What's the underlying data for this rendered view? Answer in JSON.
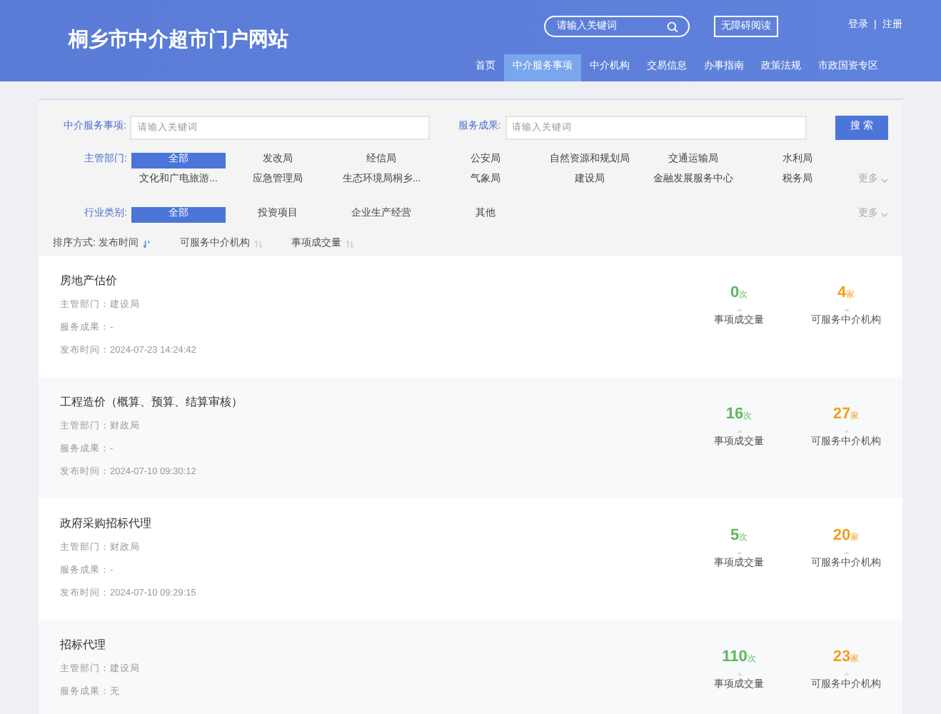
{
  "header": {
    "site_title": "桐乡市中介超市门户网站",
    "search": {
      "placeholder": "请输入关键词"
    },
    "accessibility_button": "无障碍阅读",
    "login": "登录",
    "separator": "|",
    "register": "注册"
  },
  "nav": [
    {
      "label": "首页",
      "selected": false
    },
    {
      "label": "中介服务事项",
      "selected": true
    },
    {
      "label": "中介机构",
      "selected": false
    },
    {
      "label": "交易信息",
      "selected": false
    },
    {
      "label": "办事指南",
      "selected": false
    },
    {
      "label": "政策法规",
      "selected": false
    },
    {
      "label": "市政国资专区",
      "selected": false
    }
  ],
  "filters": {
    "service_item": {
      "label": "中介服务事项:",
      "placeholder": "请输入关键词"
    },
    "service_result": {
      "label": "服务成果:",
      "placeholder": "请输入关键词"
    },
    "search_button": "搜 索",
    "department": {
      "label": "主管部门:",
      "more": "更多",
      "options": [
        {
          "label": "全部",
          "selected": true
        },
        {
          "label": "发改局",
          "selected": false
        },
        {
          "label": "经信局",
          "selected": false
        },
        {
          "label": "公安局",
          "selected": false
        },
        {
          "label": "自然资源和规划局",
          "selected": false
        },
        {
          "label": "交通运输局",
          "selected": false
        },
        {
          "label": "水利局",
          "selected": false
        },
        {
          "label": "文化和广电旅游...",
          "selected": false
        },
        {
          "label": "应急管理局",
          "selected": false
        },
        {
          "label": "生态环境局桐乡...",
          "selected": false
        },
        {
          "label": "气象局",
          "selected": false
        },
        {
          "label": "建设局",
          "selected": false
        },
        {
          "label": "金融发展服务中心",
          "selected": false
        },
        {
          "label": "税务局",
          "selected": false
        }
      ]
    },
    "industry": {
      "label": "行业类别:",
      "more": "更多",
      "options": [
        {
          "label": "全部",
          "selected": true
        },
        {
          "label": "投资项目",
          "selected": false
        },
        {
          "label": "企业生产经营",
          "selected": false
        },
        {
          "label": "其他",
          "selected": false
        }
      ]
    }
  },
  "sort": {
    "label": "排序方式:",
    "options": [
      {
        "label": "发布时间",
        "selected": true
      },
      {
        "label": "可服务中介机构",
        "selected": false
      },
      {
        "label": "事项成交量",
        "selected": false
      }
    ]
  },
  "items": [
    {
      "title": "房地产估价",
      "department": "主管部门：建设局",
      "result": "服务成果：-",
      "published": "发布时间：2024-07-23 14:24:42",
      "deals": "0",
      "deals_unit": "次",
      "deals_label": "事项成交量",
      "agencies": "4",
      "agencies_unit": "家",
      "agencies_label": "可服务中介机构"
    },
    {
      "title": "工程造价（概算、预算、结算审核）",
      "department": "主管部门：财政局",
      "result": "服务成果：-",
      "published": "发布时间：2024-07-10 09:30:12",
      "deals": "16",
      "deals_unit": "次",
      "deals_label": "事项成交量",
      "agencies": "27",
      "agencies_unit": "家",
      "agencies_label": "可服务中介机构"
    },
    {
      "title": "政府采购招标代理",
      "department": "主管部门：财政局",
      "result": "服务成果：-",
      "published": "发布时间：2024-07-10 09:29:15",
      "deals": "5",
      "deals_unit": "次",
      "deals_label": "事项成交量",
      "agencies": "20",
      "agencies_unit": "家",
      "agencies_label": "可服务中介机构"
    },
    {
      "title": "招标代理",
      "department": "主管部门：建设局",
      "result": "服务成果：无",
      "deals": "110",
      "deals_unit": "次",
      "deals_label": "事项成交量",
      "agencies": "23",
      "agencies_unit": "家",
      "agencies_label": "可服务中介机构"
    }
  ]
}
